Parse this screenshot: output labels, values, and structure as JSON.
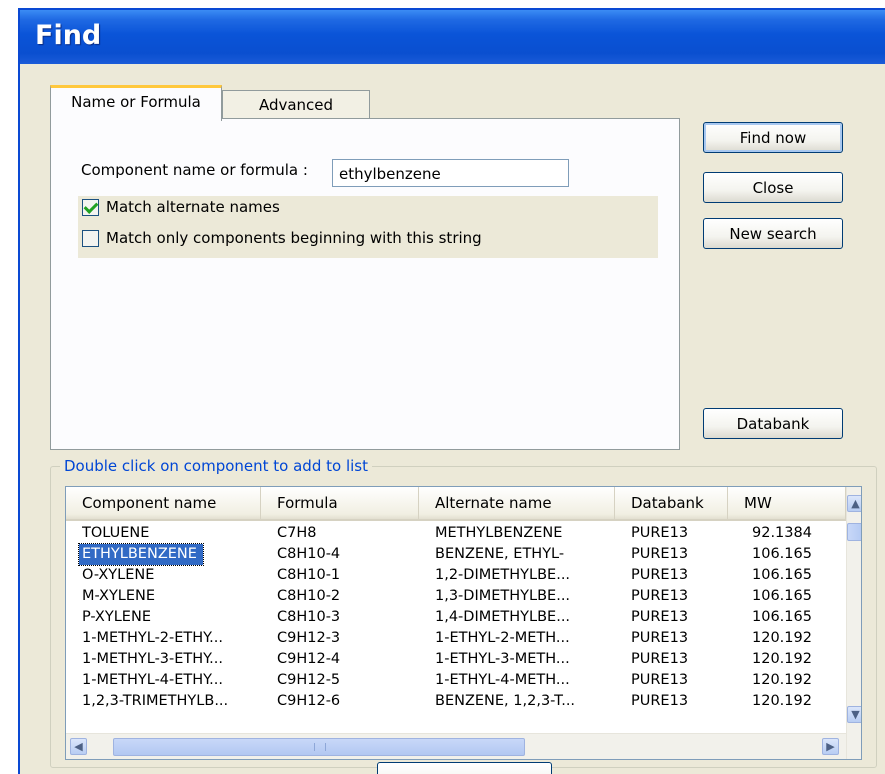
{
  "window": {
    "title": "Find"
  },
  "tabs": [
    {
      "label": "Name or Formula",
      "active": true
    },
    {
      "label": "Advanced",
      "active": false
    }
  ],
  "form": {
    "name_label": "Component name or formula :",
    "name_value": "ethylbenzene",
    "match_alternate": {
      "label": "Match alternate names",
      "checked": true
    },
    "match_beginning": {
      "label": "Match only components beginning with this string",
      "checked": false
    }
  },
  "buttons": {
    "find_now": "Find now",
    "close": "Close",
    "new_search": "New search",
    "databank": "Databank"
  },
  "results": {
    "caption": "Double click on component to add to list",
    "columns": [
      "Component name",
      "Formula",
      "Alternate name",
      "Databank",
      "MW"
    ],
    "rows": [
      [
        "TOLUENE",
        "C7H8",
        "METHYLBENZENE",
        "PURE13",
        "92.1384"
      ],
      [
        "ETHYLBENZENE",
        "C8H10-4",
        "BENZENE, ETHYL-",
        "PURE13",
        "106.165"
      ],
      [
        "O-XYLENE",
        "C8H10-1",
        "1,2-DIMETHYLBE...",
        "PURE13",
        "106.165"
      ],
      [
        "M-XYLENE",
        "C8H10-2",
        "1,3-DIMETHYLBE...",
        "PURE13",
        "106.165"
      ],
      [
        "P-XYLENE",
        "C8H10-3",
        "1,4-DIMETHYLBE...",
        "PURE13",
        "106.165"
      ],
      [
        "1-METHYL-2-ETHY...",
        "C9H12-3",
        "1-ETHYL-2-METH...",
        "PURE13",
        "120.192"
      ],
      [
        "1-METHYL-3-ETHY...",
        "C9H12-4",
        "1-ETHYL-3-METH...",
        "PURE13",
        "120.192"
      ],
      [
        "1-METHYL-4-ETHY...",
        "C9H12-5",
        "1-ETHYL-4-METH...",
        "PURE13",
        "120.192"
      ],
      [
        "1,2,3-TRIMETHYLB...",
        "C9H12-6",
        "BENZENE, 1,2,3-T...",
        "PURE13",
        "120.192"
      ]
    ],
    "selected_row": 1
  },
  "icons": {
    "scroll_up": "chevron-up-icon",
    "scroll_down": "chevron-down-icon",
    "scroll_left": "chevron-left-icon",
    "scroll_right": "chevron-right-icon"
  },
  "colors": {
    "titlebar": "#0a54d8",
    "selection": "#316ac5",
    "active_tab_accent": "#ffc83c",
    "group_caption": "#0046d5"
  }
}
